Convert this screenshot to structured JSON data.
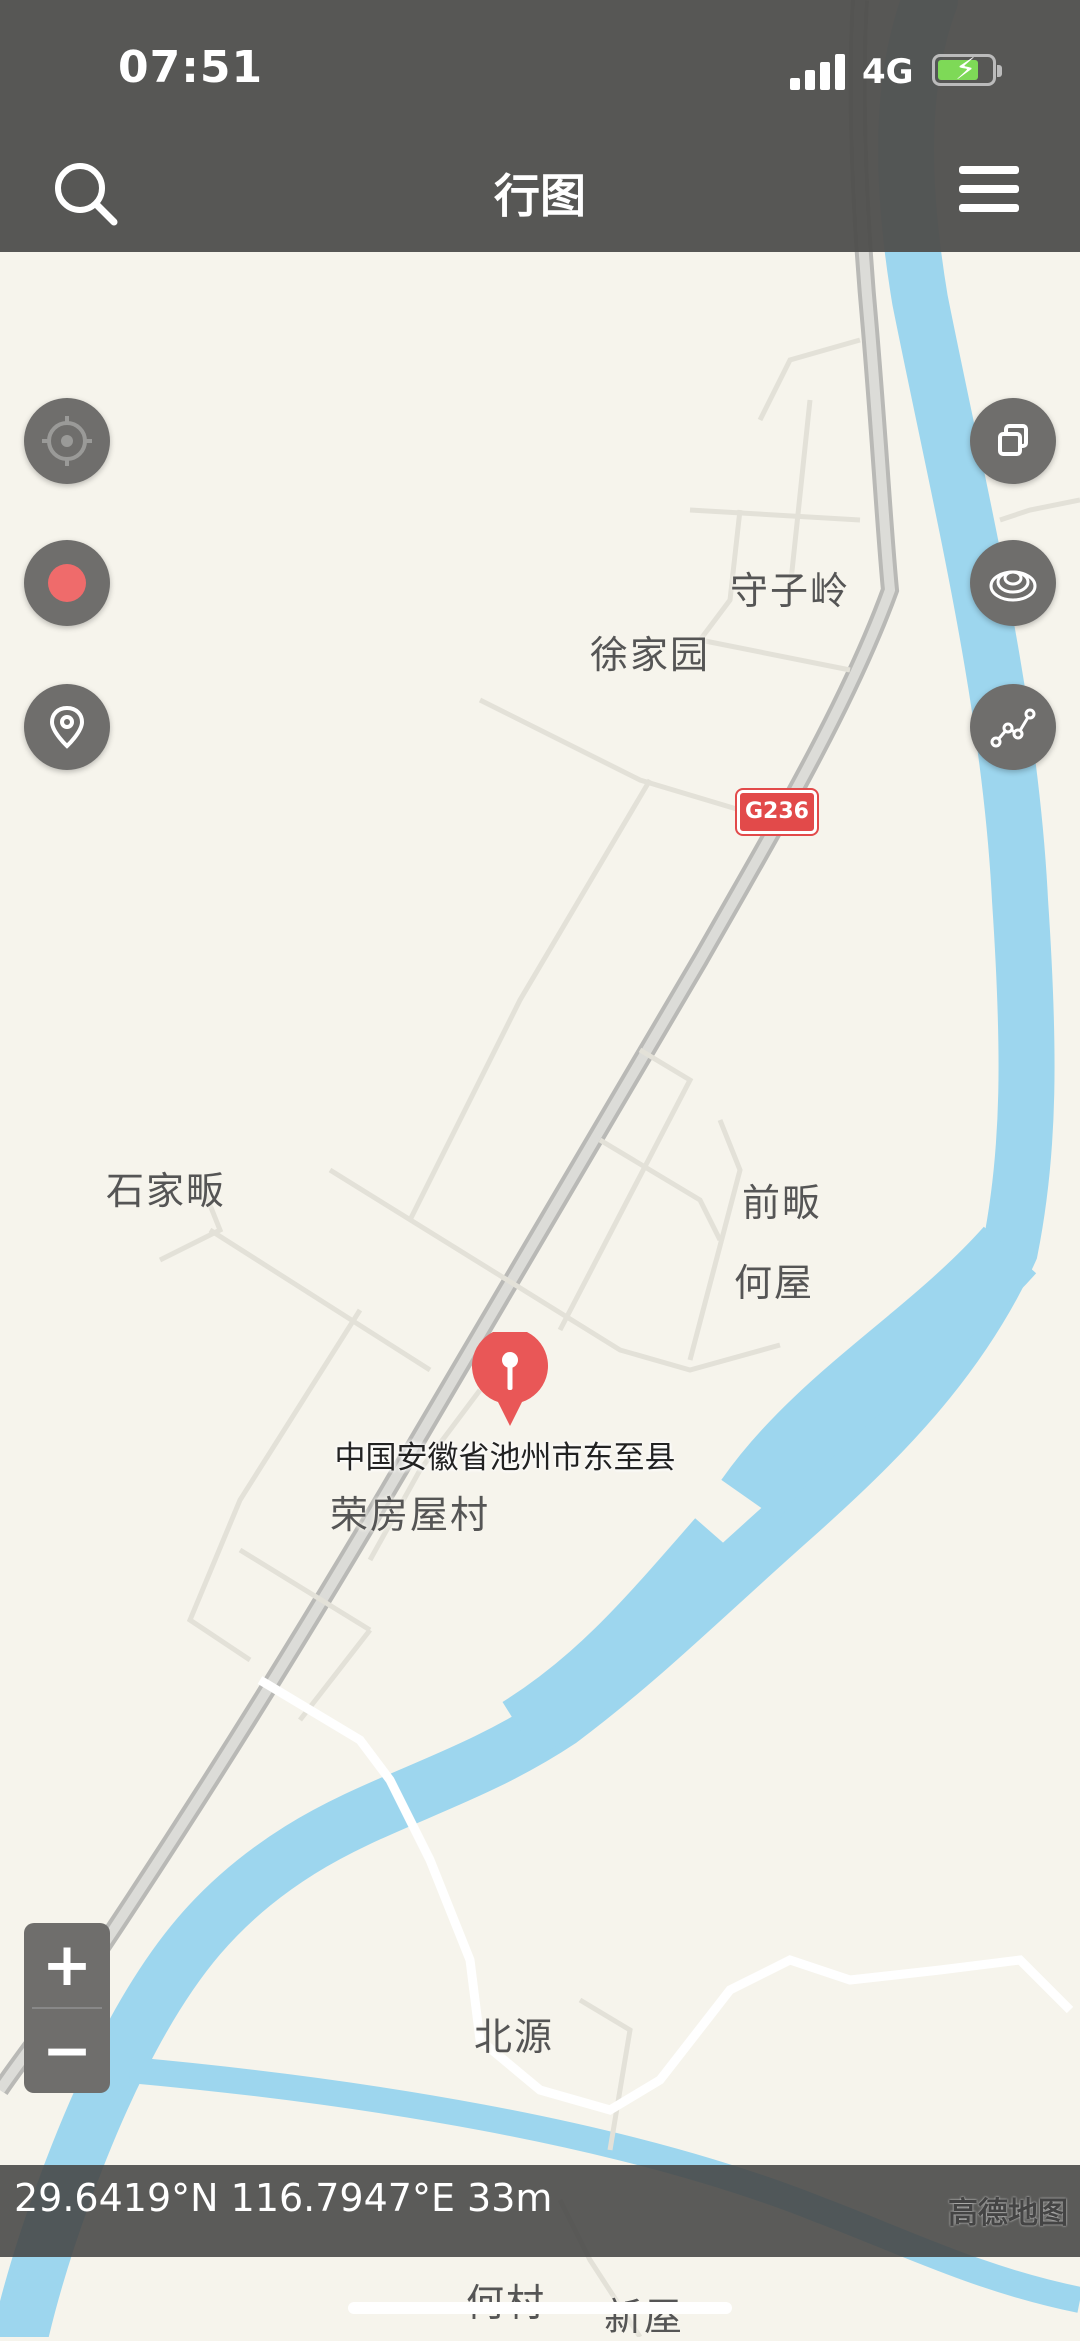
{
  "status_bar": {
    "time": "07:51",
    "network": "4G"
  },
  "nav": {
    "title": "行图"
  },
  "map": {
    "road_shield": "G236",
    "places": [
      "守子岭",
      "徐家园",
      "石家畈",
      "前畈",
      "何屋",
      "荣房屋村",
      "北源",
      "何村",
      "新屋"
    ],
    "marker_address": "中国安徽省池州市东至县"
  },
  "coordinates": {
    "text": "29.6419°N 116.7947°E  33m"
  },
  "attribution": "高德地图",
  "zoom": {
    "in_label": "+",
    "out_label": "−"
  }
}
